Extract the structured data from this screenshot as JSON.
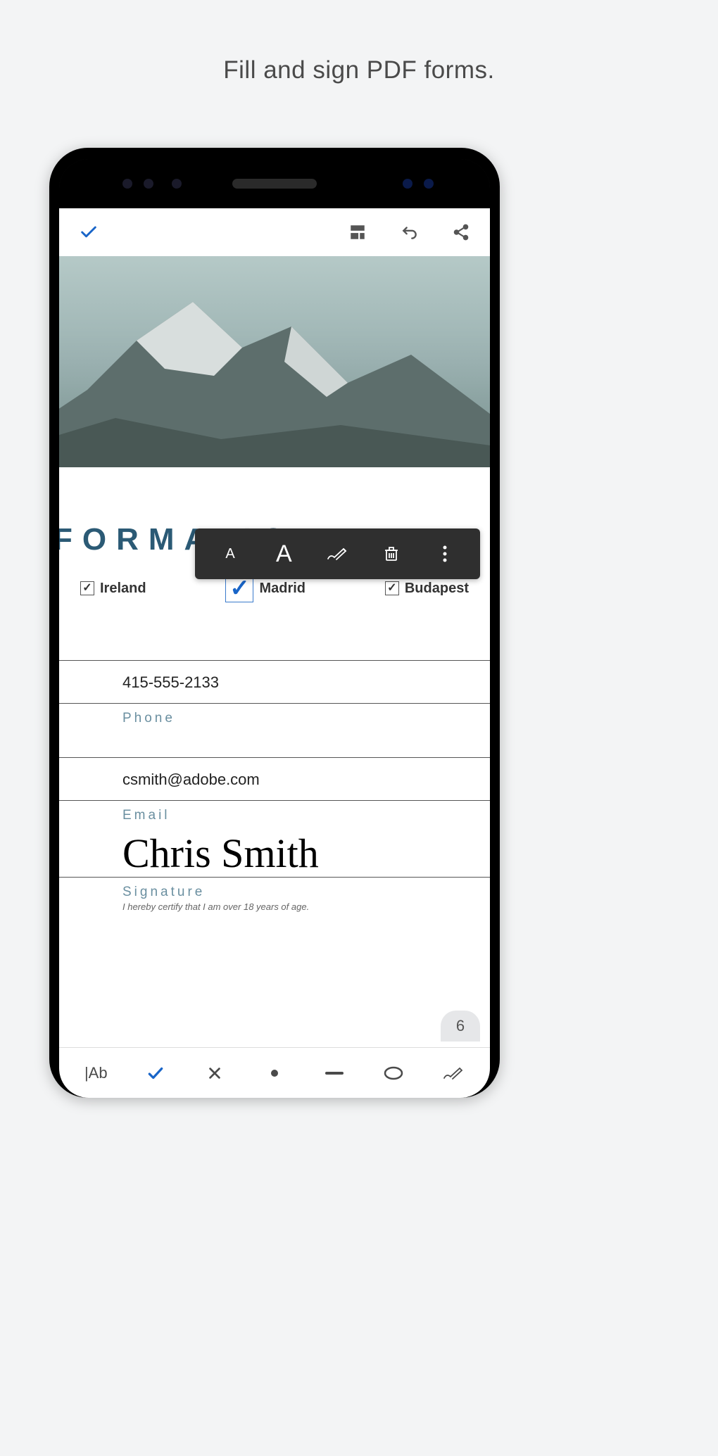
{
  "caption": "Fill and sign PDF forms.",
  "heading": "FORMATION",
  "checkboxes": [
    {
      "label": "Ireland",
      "checked": true,
      "highlight": false
    },
    {
      "label": "Madrid",
      "checked": true,
      "highlight": true
    },
    {
      "label": "Budapest",
      "checked": true,
      "highlight": false
    }
  ],
  "phone": {
    "value": "415-555-2133",
    "label": "Phone"
  },
  "email": {
    "value": "csmith@adobe.com",
    "label": "Email"
  },
  "signature": {
    "value": "Chris Smith",
    "label": "Signature"
  },
  "certify": "I hereby certify that I am over 18 years of age.",
  "page_badge": "6",
  "bottom_tools": {
    "text_tool": "|Ab"
  },
  "context_tools": {
    "small_a": "A",
    "big_a": "A"
  },
  "colors": {
    "accent_blue": "#1965c8",
    "teal_heading": "#2b5a75",
    "label_gray": "#6a8fa0"
  }
}
